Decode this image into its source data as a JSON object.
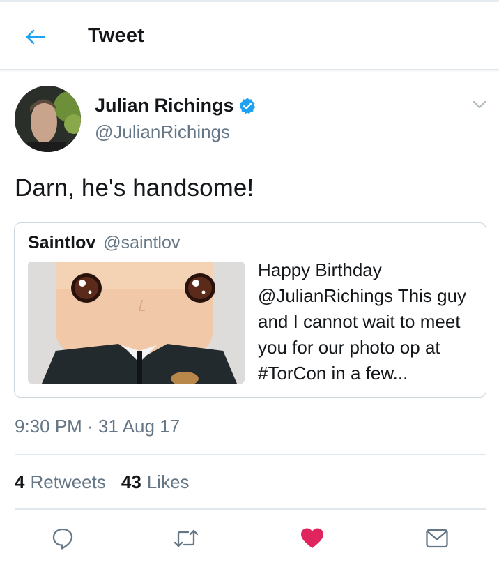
{
  "header": {
    "title": "Tweet",
    "back_icon": "arrow-left-icon"
  },
  "tweet": {
    "author_name": "Julian Richings",
    "author_handle": "@JulianRichings",
    "verified": true,
    "text": "Darn, he's handsome!",
    "timestamp": "9:30 PM · 31 Aug 17",
    "retweets_count": "4",
    "retweets_label": "Retweets",
    "likes_count": "43",
    "likes_label": "Likes",
    "liked": true
  },
  "quoted_tweet": {
    "author_name": "Saintlov",
    "author_handle": "@saintlov",
    "text": "Happy Birthday @JulianRichings This guy and I cannot wait to meet you for our photo op at  #TorCon in a few..."
  },
  "colors": {
    "accent": "#1da1f2",
    "like": "#e0245e",
    "text": "#14171a",
    "secondary": "#657786",
    "border": "#e1e8ed"
  },
  "icons": [
    "arrow-left-icon",
    "verified-badge-icon",
    "chevron-down-icon",
    "reply-icon",
    "retweet-icon",
    "heart-icon",
    "share-icon"
  ]
}
